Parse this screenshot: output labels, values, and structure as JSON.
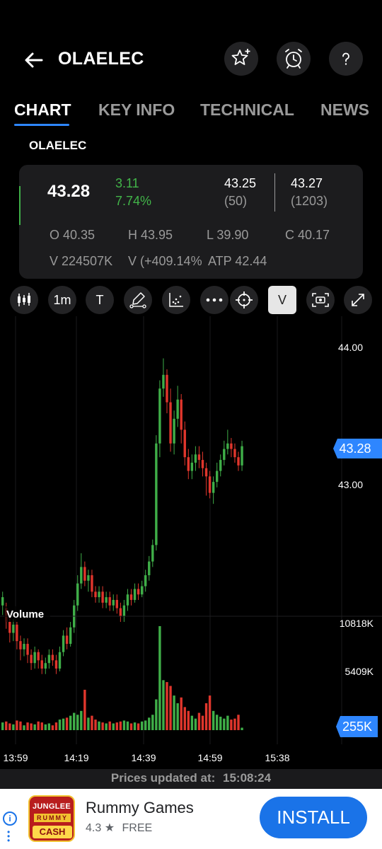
{
  "header": {
    "title": "OLAELEC"
  },
  "tabs": [
    "CHART",
    "KEY INFO",
    "TECHNICAL",
    "NEWS"
  ],
  "symbol": "OLAELEC",
  "quote": {
    "ltp": "43.28",
    "change": "3.11",
    "change_pct": "7.74%",
    "bid_price": "43.25",
    "bid_qty": "(50)",
    "ask_price": "43.27",
    "ask_qty": "(1203)",
    "open": "O 40.35",
    "high": "H 43.95",
    "low": "L 39.90",
    "close": "C 40.17",
    "volume": "V 224507K",
    "volume_change": "V (+409.14%",
    "atp": "ATP 42.44"
  },
  "toolbar": {
    "interval": "1m",
    "text_tool": "T",
    "volume_toggle": "V"
  },
  "chart": {
    "price_labels": [
      "44.00",
      "43.00"
    ],
    "current_price": "43.28",
    "volume_title": "Volume",
    "volume_labels": [
      "10818K",
      "5409K"
    ],
    "current_volume": "255K",
    "time_labels": [
      "13:59",
      "14:19",
      "14:39",
      "14:59",
      "15:38"
    ]
  },
  "footer": {
    "updated_label": "Prices updated at:",
    "updated_time": "15:08:24"
  },
  "ad": {
    "logo_line1": "JUNGLEE",
    "logo_line2": "RUMMY",
    "logo_line3": "CASH",
    "title": "Rummy Games",
    "rating": "4.3",
    "star": "★",
    "price": "FREE",
    "cta": "INSTALL"
  },
  "colors": {
    "up": "#3fae48",
    "down": "#e0362c",
    "accent": "#2e86ff"
  },
  "chart_data": {
    "type": "candlestick",
    "price_axis": [
      42.2,
      44.3
    ],
    "volume_axis_max_k": 10818,
    "bars": [
      [
        42.18,
        42.12,
        42.22,
        42.05,
        0,
        800
      ],
      [
        42.1,
        42.0,
        42.14,
        41.95,
        1,
        900
      ],
      [
        42.0,
        41.92,
        42.05,
        41.85,
        1,
        700
      ],
      [
        41.92,
        41.98,
        42.02,
        41.86,
        0,
        600
      ],
      [
        41.98,
        41.86,
        42.0,
        41.8,
        1,
        1000
      ],
      [
        41.86,
        41.8,
        41.9,
        41.72,
        1,
        900
      ],
      [
        41.8,
        41.84,
        41.88,
        41.75,
        0,
        500
      ],
      [
        41.84,
        41.76,
        41.88,
        41.7,
        1,
        800
      ],
      [
        41.76,
        41.7,
        41.8,
        41.65,
        1,
        700
      ],
      [
        41.7,
        41.78,
        41.82,
        41.66,
        0,
        600
      ],
      [
        41.78,
        41.72,
        41.8,
        41.66,
        1,
        900
      ],
      [
        41.72,
        41.66,
        41.76,
        41.62,
        1,
        800
      ],
      [
        41.66,
        41.7,
        41.74,
        41.62,
        0,
        600
      ],
      [
        41.7,
        41.76,
        41.8,
        41.66,
        0,
        700
      ],
      [
        41.76,
        41.72,
        41.8,
        41.68,
        1,
        500
      ],
      [
        41.72,
        41.66,
        41.76,
        41.62,
        1,
        800
      ],
      [
        41.66,
        41.78,
        41.82,
        41.64,
        0,
        1100
      ],
      [
        41.78,
        41.9,
        41.94,
        41.75,
        0,
        1200
      ],
      [
        41.9,
        41.84,
        41.96,
        41.8,
        1,
        1300
      ],
      [
        41.84,
        41.96,
        42.0,
        41.82,
        0,
        1500
      ],
      [
        41.96,
        42.12,
        42.16,
        41.92,
        0,
        1800
      ],
      [
        42.12,
        42.28,
        42.34,
        42.08,
        0,
        1600
      ],
      [
        42.28,
        42.4,
        42.5,
        42.24,
        0,
        2000
      ],
      [
        42.4,
        42.3,
        42.44,
        42.26,
        1,
        4200
      ],
      [
        42.3,
        42.34,
        42.38,
        42.22,
        0,
        1300
      ],
      [
        42.34,
        42.22,
        42.38,
        42.18,
        1,
        1500
      ],
      [
        42.22,
        42.18,
        42.26,
        42.14,
        1,
        1100
      ],
      [
        42.18,
        42.22,
        42.26,
        42.14,
        0,
        900
      ],
      [
        42.22,
        42.14,
        42.26,
        42.1,
        1,
        800
      ],
      [
        42.14,
        42.18,
        42.22,
        42.1,
        0,
        700
      ],
      [
        42.18,
        42.12,
        42.22,
        42.08,
        1,
        900
      ],
      [
        42.12,
        42.16,
        42.2,
        42.08,
        0,
        700
      ],
      [
        42.16,
        42.1,
        42.2,
        42.06,
        1,
        800
      ],
      [
        42.1,
        42.04,
        42.14,
        42.0,
        1,
        900
      ],
      [
        42.04,
        42.12,
        42.16,
        42.0,
        0,
        1000
      ],
      [
        42.12,
        42.2,
        42.24,
        42.08,
        0,
        900
      ],
      [
        42.2,
        42.16,
        42.24,
        42.12,
        1,
        700
      ],
      [
        42.16,
        42.24,
        42.28,
        42.14,
        0,
        800
      ],
      [
        42.24,
        42.2,
        42.28,
        42.16,
        1,
        700
      ],
      [
        42.2,
        42.26,
        42.3,
        42.18,
        0,
        900
      ],
      [
        42.26,
        42.34,
        42.38,
        42.22,
        0,
        1000
      ],
      [
        42.34,
        42.44,
        42.48,
        42.3,
        0,
        1300
      ],
      [
        42.44,
        42.56,
        42.6,
        42.4,
        0,
        1600
      ],
      [
        42.56,
        43.3,
        43.36,
        42.52,
        0,
        3200
      ],
      [
        43.3,
        43.7,
        43.76,
        43.2,
        0,
        10818
      ],
      [
        43.7,
        43.8,
        43.92,
        43.64,
        0,
        5200
      ],
      [
        43.8,
        43.6,
        43.84,
        43.52,
        1,
        5000
      ],
      [
        43.6,
        43.3,
        43.7,
        43.24,
        1,
        4600
      ],
      [
        43.3,
        43.48,
        43.54,
        43.22,
        0,
        3600
      ],
      [
        43.48,
        43.62,
        43.72,
        43.42,
        0,
        2800
      ],
      [
        43.62,
        43.4,
        43.66,
        43.3,
        1,
        3400
      ],
      [
        43.4,
        43.2,
        43.46,
        43.14,
        1,
        2400
      ],
      [
        43.2,
        43.1,
        43.26,
        43.04,
        1,
        2000
      ],
      [
        43.1,
        43.16,
        43.22,
        43.04,
        0,
        1500
      ],
      [
        43.16,
        43.22,
        43.28,
        43.1,
        0,
        1200
      ],
      [
        43.22,
        43.18,
        43.28,
        43.12,
        1,
        1800
      ],
      [
        43.18,
        43.12,
        43.24,
        43.06,
        1,
        1500
      ],
      [
        43.12,
        43.06,
        43.16,
        42.92,
        1,
        2800
      ],
      [
        43.06,
        42.94,
        43.1,
        42.9,
        1,
        3600
      ],
      [
        42.94,
        43.02,
        43.06,
        42.86,
        0,
        2000
      ],
      [
        43.02,
        43.1,
        43.16,
        42.98,
        0,
        1600
      ],
      [
        43.1,
        43.18,
        43.22,
        43.06,
        0,
        1400
      ],
      [
        43.18,
        43.26,
        43.32,
        43.14,
        0,
        1200
      ],
      [
        43.26,
        43.3,
        43.4,
        43.22,
        0,
        1500
      ],
      [
        43.3,
        43.26,
        43.34,
        43.2,
        1,
        1100
      ],
      [
        43.26,
        43.2,
        43.3,
        43.16,
        1,
        1200
      ],
      [
        43.2,
        43.14,
        43.24,
        43.1,
        1,
        1600
      ],
      [
        43.14,
        43.28,
        43.32,
        43.1,
        0,
        255
      ]
    ]
  }
}
